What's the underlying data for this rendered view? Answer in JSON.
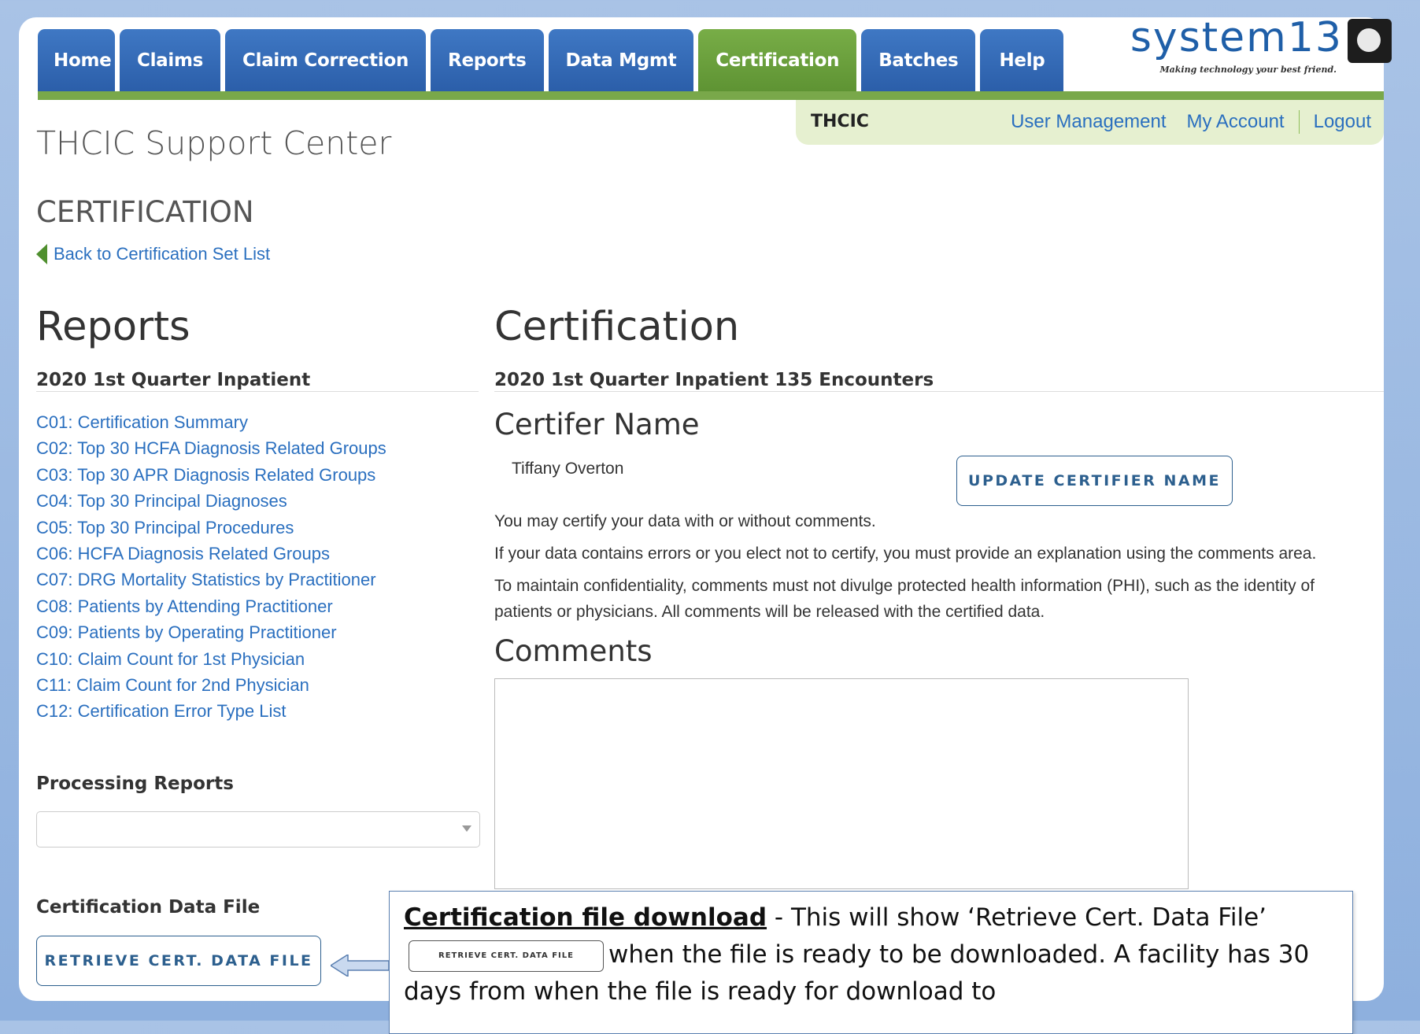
{
  "nav": {
    "tabs": [
      {
        "label": "Home",
        "active": false
      },
      {
        "label": "Claims",
        "active": false
      },
      {
        "label": "Claim Correction",
        "active": false
      },
      {
        "label": "Reports",
        "active": false
      },
      {
        "label": "Data Mgmt",
        "active": false
      },
      {
        "label": "Certification",
        "active": true
      },
      {
        "label": "Batches",
        "active": false
      },
      {
        "label": "Help",
        "active": false
      }
    ]
  },
  "logo": {
    "name": "system13",
    "tagline": "Making technology your best friend."
  },
  "header": {
    "org": "THCIC",
    "links": {
      "user_management": "User Management",
      "my_account": "My Account",
      "logout": "Logout"
    }
  },
  "site_title": "THCIC Support Center",
  "page_title": "CERTIFICATION",
  "back_link": "Back to Certification Set List",
  "reports": {
    "heading": "Reports",
    "subheading": "2020 1st Quarter Inpatient",
    "items": [
      "C01: Certification Summary",
      "C02: Top 30 HCFA Diagnosis Related Groups",
      "C03: Top 30 APR Diagnosis Related Groups",
      "C04: Top 30 Principal Diagnoses",
      "C05: Top 30 Principal Procedures",
      "C06: HCFA Diagnosis Related Groups",
      "C07: DRG Mortality Statistics by Practitioner",
      "C08: Patients by Attending Practitioner",
      "C09: Patients by Operating Practitioner",
      "C10: Claim Count for 1st Physician",
      "C11: Claim Count for 2nd Physician",
      "C12: Certification Error Type List"
    ],
    "processing_heading": "Processing Reports",
    "processing_selected": "",
    "data_file_heading": "Certification Data File",
    "retrieve_button": "RETRIEVE CERT. DATA FILE"
  },
  "certification": {
    "heading": "Certification",
    "subheading": "2020 1st Quarter Inpatient 135 Encounters",
    "certifier_heading": "Certifer Name",
    "certifier_name": "Tiffany Overton",
    "update_button": "UPDATE CERTIFIER NAME",
    "para1": "You may certify your data with or without comments.",
    "para2": "If your data contains errors or you elect not to certify, you must provide an explanation using the comments area.",
    "para3": "To maintain confidentiality, comments must not divulge protected health information (PHI), such as the identity of patients or physicians. All comments will be released with the certified data.",
    "comments_heading": "Comments",
    "comments_value": ""
  },
  "callout": {
    "title": "Certification file download",
    "text1": " - This will show ‘Retrieve Cert. Data File’",
    "button": "RETRIEVE CERT. DATA FILE",
    "text2": "when the file is ready to be downloaded.  A facility has 30 days from when the file is ready for download to"
  }
}
